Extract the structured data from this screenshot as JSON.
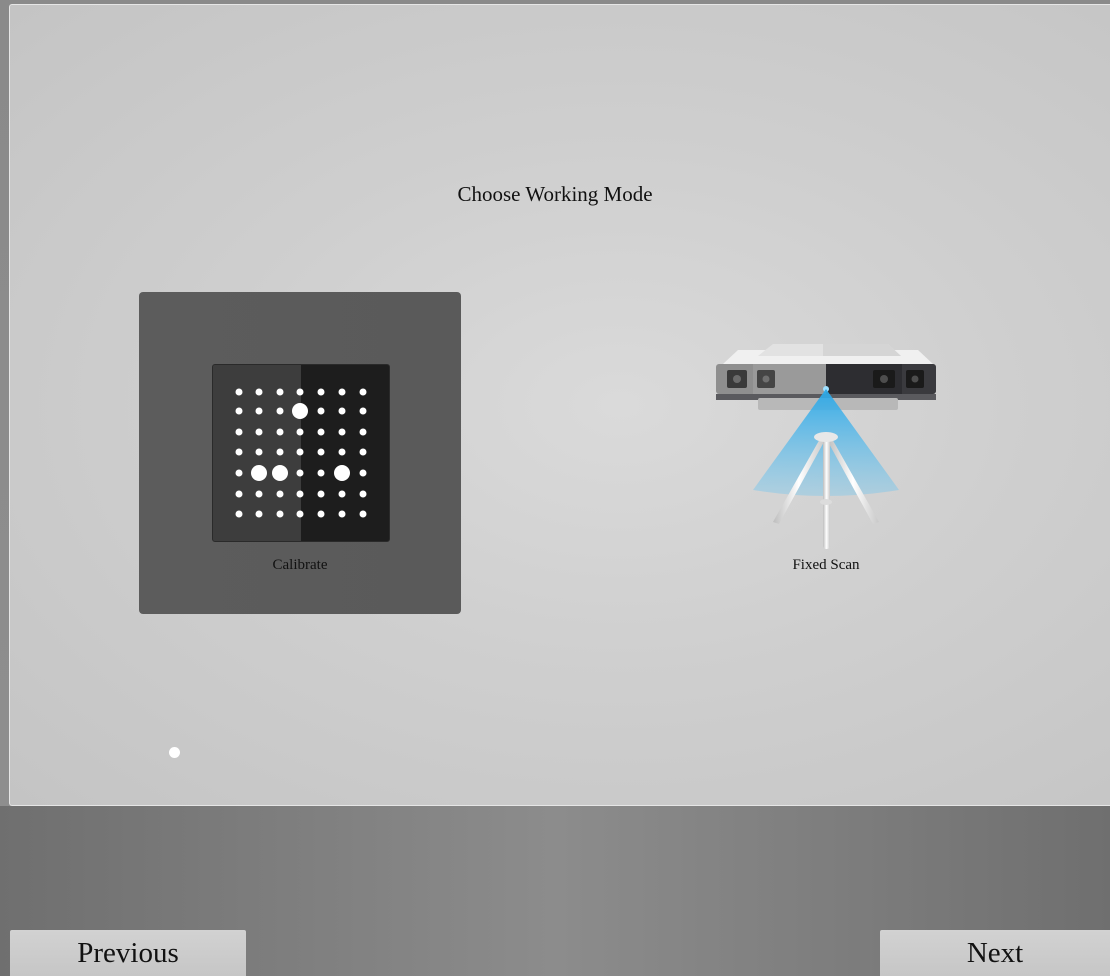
{
  "page": {
    "title": "Choose Working Mode"
  },
  "modes": [
    {
      "label": "Calibrate",
      "icon": "calibration-board-icon",
      "selected": true
    },
    {
      "label": "Fixed Scan",
      "icon": "scanner-on-tripod-icon",
      "selected": false
    }
  ],
  "pager": {
    "current_page": 1
  },
  "nav": {
    "previous_label": "Previous",
    "next_label": "Next"
  },
  "colors": {
    "selected_card": "#5c5c5c",
    "panel_background": "#d0d0d0",
    "scan_beam": "#29a9e6"
  }
}
